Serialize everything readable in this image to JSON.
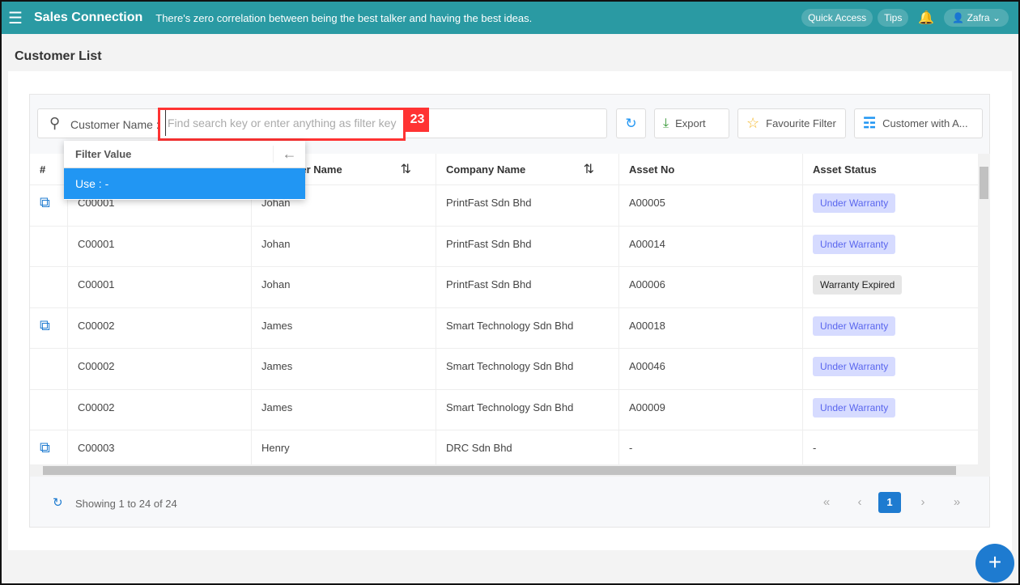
{
  "header": {
    "app_title": "Sales Connection",
    "quote": "There's zero correlation between being the best talker and having the best ideas.",
    "quick_access": "Quick Access",
    "tips": "Tips",
    "user": "Zafra",
    "brand_color": "#2a9aa3"
  },
  "page": {
    "title": "Customer List"
  },
  "toolbar": {
    "search_label": "Customer Name :",
    "search_placeholder": "Find search key or enter anything as filter key",
    "annotation": "23",
    "export": "Export",
    "favourite": "Favourite Filter",
    "view": "Customer with A..."
  },
  "dropdown": {
    "title": "Filter Value",
    "option": "Use : -"
  },
  "table": {
    "columns": [
      "#",
      "",
      "Customer Name",
      "Company Name",
      "Asset No",
      "Asset Status"
    ],
    "rows": [
      {
        "link": true,
        "code": "C00001",
        "name": "Johan",
        "company": "PrintFast Sdn Bhd",
        "asset": "A00005",
        "status": "Under Warranty"
      },
      {
        "link": false,
        "code": "C00001",
        "name": "Johan",
        "company": "PrintFast Sdn Bhd",
        "asset": "A00014",
        "status": "Under Warranty"
      },
      {
        "link": false,
        "code": "C00001",
        "name": "Johan",
        "company": "PrintFast Sdn Bhd",
        "asset": "A00006",
        "status": "Warranty Expired"
      },
      {
        "link": true,
        "code": "C00002",
        "name": "James",
        "company": "Smart Technology Sdn Bhd",
        "asset": "A00018",
        "status": "Under Warranty"
      },
      {
        "link": false,
        "code": "C00002",
        "name": "James",
        "company": "Smart Technology Sdn Bhd",
        "asset": "A00046",
        "status": "Under Warranty"
      },
      {
        "link": false,
        "code": "C00002",
        "name": "James",
        "company": "Smart Technology Sdn Bhd",
        "asset": "A00009",
        "status": "Under Warranty"
      },
      {
        "link": true,
        "code": "C00003",
        "name": "Henry",
        "company": "DRC Sdn Bhd",
        "asset": "-",
        "status": "-"
      }
    ]
  },
  "footer": {
    "showing": "Showing 1 to 24 of 24",
    "page": "1"
  }
}
